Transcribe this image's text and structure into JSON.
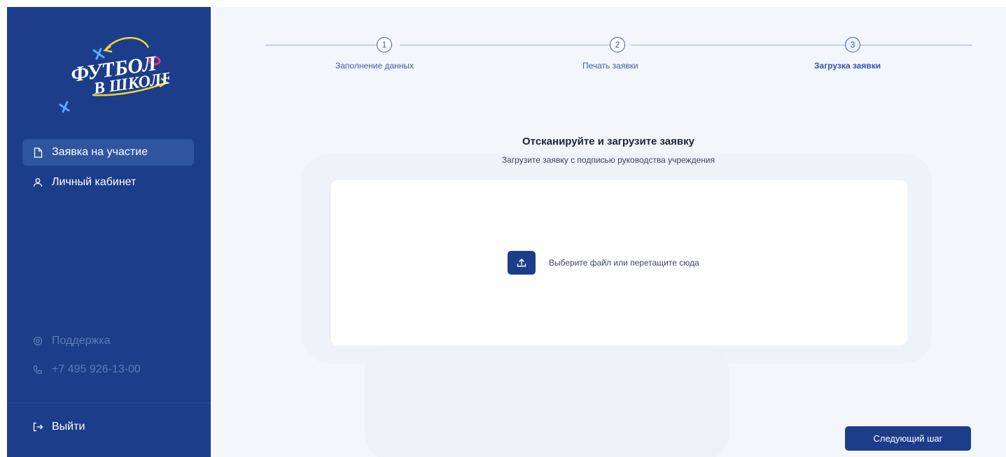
{
  "brand": {
    "logo_text": "ФУТБОЛ В ШКОЛЕ"
  },
  "sidebar": {
    "items": [
      {
        "label": "Заявка на участие",
        "icon": "document-icon",
        "active": true
      },
      {
        "label": "Личный кабинет",
        "icon": "user-icon",
        "active": false
      }
    ],
    "support_label": "Поддержка",
    "phone": "+7 495 926-13-00",
    "logout_label": "Выйти"
  },
  "stepper": {
    "steps": [
      {
        "number": "1",
        "label": "Заполнение данных",
        "state": "done"
      },
      {
        "number": "2",
        "label": "Печать заявки",
        "state": "done"
      },
      {
        "number": "3",
        "label": "Загрузка заявки",
        "state": "current"
      }
    ]
  },
  "main": {
    "title": "Отсканируйте и загрузите заявку",
    "subtitle": "Загрузите заявку с подписью руководства учреждения",
    "upload": {
      "label": "Выберите файл или перетащите сюда",
      "icon": "upload-icon"
    },
    "next_label": "Следующий шаг"
  },
  "colors": {
    "sidebar_bg": "#1c3d8a",
    "active_item_bg": "#2f559f",
    "accent": "#2e55b5",
    "page_bg": "#f3f6fb"
  }
}
